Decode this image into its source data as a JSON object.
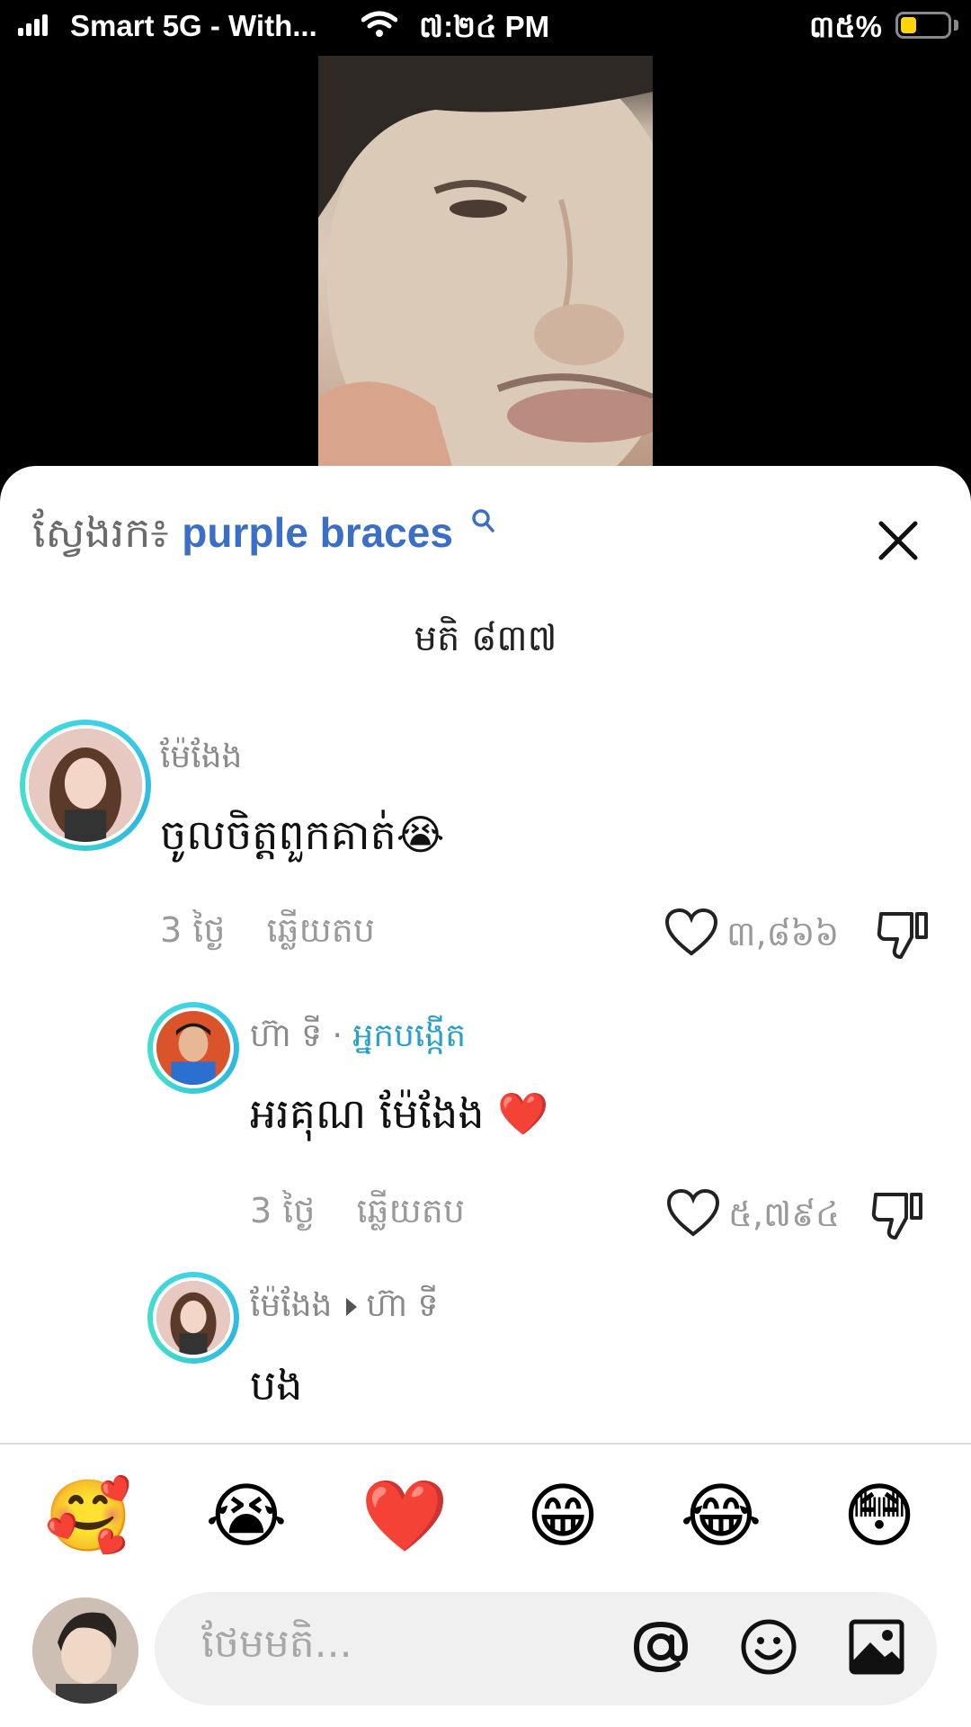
{
  "status_bar": {
    "carrier": "Smart 5G - With...",
    "time": "៧:២៤ PM",
    "battery_percent": "៣៥%",
    "battery_level": 0.25
  },
  "search": {
    "prefix": "ស្វែងរក៖",
    "term": "purple braces"
  },
  "comments_header": {
    "count_label": "មតិ ៨៣៧"
  },
  "comments": [
    {
      "author": "ម៉ែងែង",
      "text": "ចូលចិត្តពួកគាត់😭",
      "age": "3 ថ្ងៃ",
      "reply_label": "ឆ្លើយតប",
      "likes": "៣,៨៦៦"
    },
    {
      "author": "ហ៊ា ទី",
      "separator": "·",
      "creator_tag": "អ្នកបង្កើត",
      "text": "អរគុណ ម៉ែងែង ❤️",
      "age": "3 ថ្ងៃ",
      "reply_label": "ឆ្លើយតប",
      "likes": "៥,៧៩៤"
    },
    {
      "author": "ម៉ែងែង",
      "reply_to": "ហ៊ា ទី",
      "text": "បង"
    }
  ],
  "emoji_bar": [
    "🥰",
    "😭",
    "❤️",
    "😁",
    "😂",
    "😳"
  ],
  "composer": {
    "placeholder": "ថែមមតិ..."
  },
  "colors": {
    "search_term": "#3b6fc7",
    "creator_tag": "#2a9fc8",
    "avatar_ring": "#3fd3e6"
  }
}
